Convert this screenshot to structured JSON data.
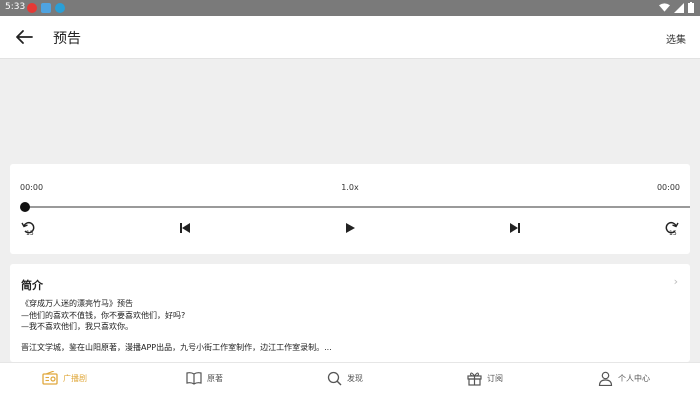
{
  "status_bar": {
    "time": "5:33"
  },
  "app_bar": {
    "title": "预告",
    "episodes_label": "选集"
  },
  "player": {
    "current_time": "00:00",
    "speed": "1.0x",
    "total_time": "00:00",
    "progress": 0,
    "skip_back_seconds": "15",
    "skip_forward_seconds": "15"
  },
  "intro": {
    "title": "简介",
    "lines": [
      "《穿成万人迷的漂亮竹马》预告",
      "—他们的喜欢不值钱，你不要喜欢他们，好吗?",
      "—我不喜欢他们，我只喜欢你。",
      "晋江文学城，鉴在山阳原著，漫播APP出品，九号小街工作室制作，边江工作室录制。..."
    ]
  },
  "bottom_nav": {
    "items": [
      {
        "label": "广播剧",
        "icon": "radio-icon",
        "active": true
      },
      {
        "label": "原著",
        "icon": "book-icon",
        "active": false
      },
      {
        "label": "发现",
        "icon": "search-icon",
        "active": false
      },
      {
        "label": "订阅",
        "icon": "gift-icon",
        "active": false
      },
      {
        "label": "个人中心",
        "icon": "person-icon",
        "active": false
      }
    ]
  },
  "colors": {
    "accent": "#e0a83c",
    "status_bar": "#7a7a7a",
    "background": "#efefef"
  }
}
